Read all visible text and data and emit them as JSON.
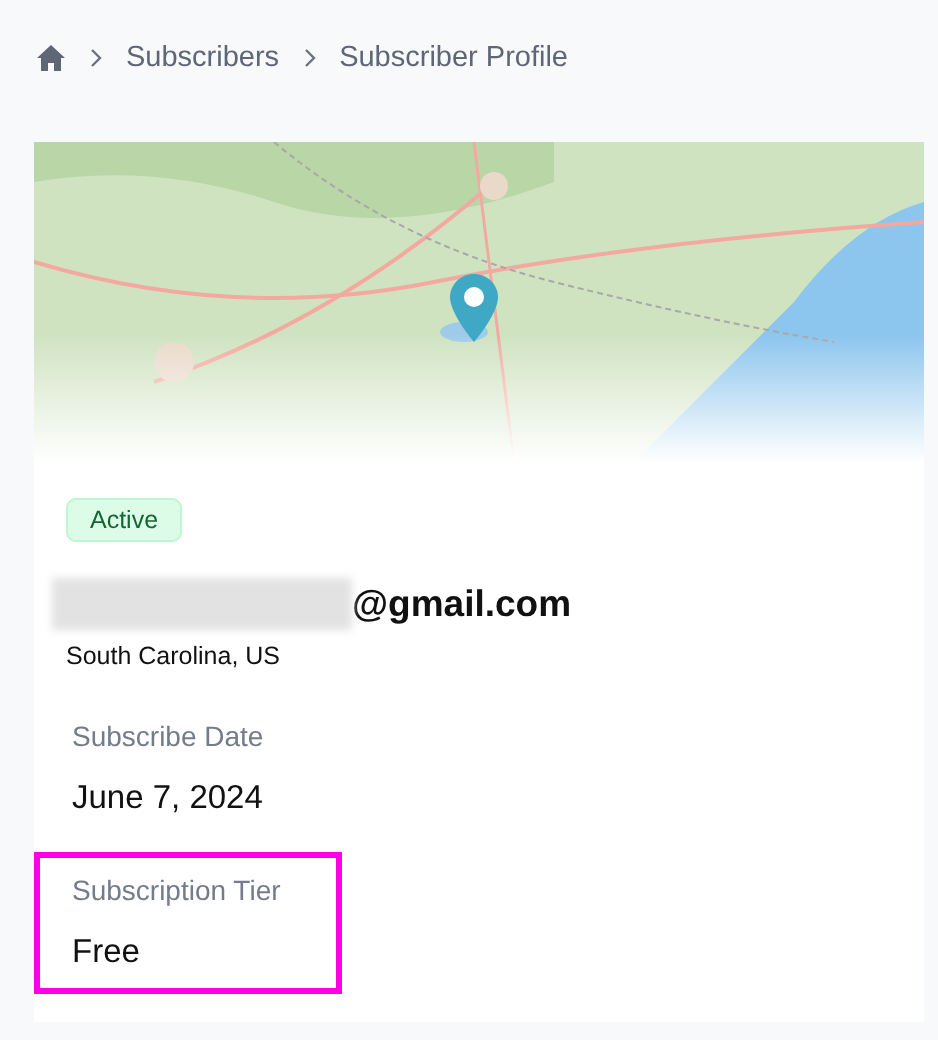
{
  "breadcrumb": [
    {
      "label": "Subscribers"
    },
    {
      "label": "Subscriber Profile"
    }
  ],
  "profile": {
    "status": "Active",
    "email_domain": "@gmail.com",
    "location": "South Carolina, US",
    "fields": [
      {
        "label": "Subscribe Date",
        "value": "June 7, 2024",
        "highlighted": false
      },
      {
        "label": "Subscription Tier",
        "value": "Free",
        "highlighted": true
      }
    ]
  }
}
